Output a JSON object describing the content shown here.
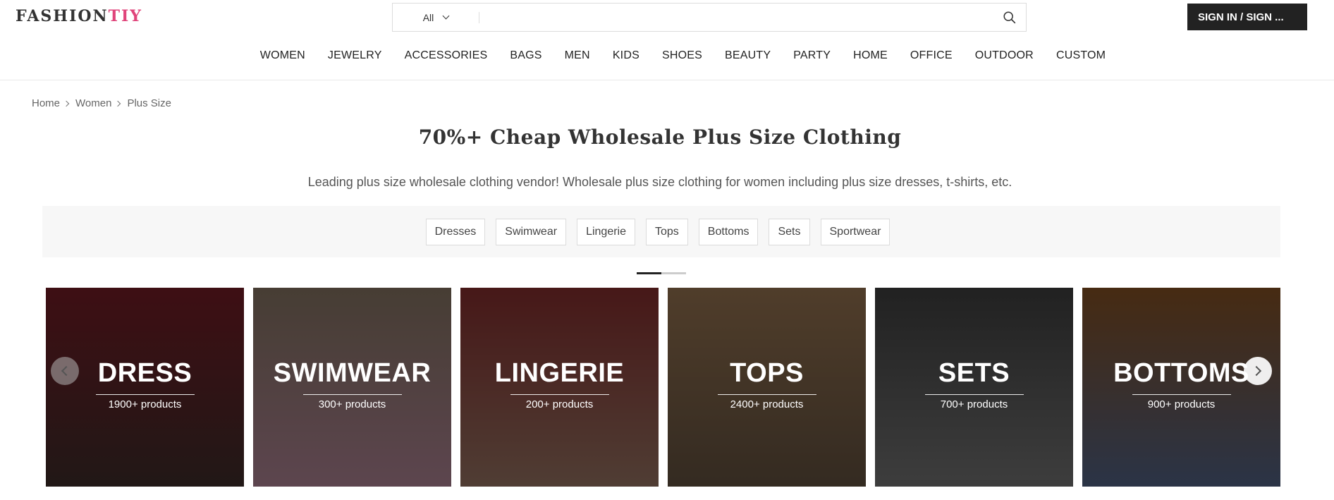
{
  "logo": {
    "main": "FASHION",
    "accent": "TIY"
  },
  "search": {
    "category": "All",
    "placeholder": ""
  },
  "signin_label": "SIGN IN / SIGN ...",
  "nav": [
    "WOMEN",
    "JEWELRY",
    "ACCESSORIES",
    "BAGS",
    "MEN",
    "KIDS",
    "SHOES",
    "BEAUTY",
    "PARTY",
    "HOME",
    "OFFICE",
    "OUTDOOR",
    "CUSTOM"
  ],
  "breadcrumb": [
    "Home",
    "Women",
    "Plus Size"
  ],
  "title": "70%+ Cheap Wholesale Plus Size Clothing",
  "description": "Leading plus size wholesale clothing vendor! Wholesale plus size clothing for women including plus size dresses, t-shirts, etc.",
  "filters": [
    "Dresses",
    "Swimwear",
    "Lingerie",
    "Tops",
    "Bottoms",
    "Sets",
    "Sportwear"
  ],
  "carousel": {
    "page": 1,
    "page_count": 2,
    "cards": [
      {
        "name": "DRESS",
        "count": "1900+ products",
        "colors": [
          "#6b1a24",
          "#3a2a26"
        ]
      },
      {
        "name": "SWIMWEAR",
        "count": "300+ products",
        "colors": [
          "#7a6a5a",
          "#a07888"
        ]
      },
      {
        "name": "LINGERIE",
        "count": "200+ products",
        "colors": [
          "#7a2a2a",
          "#8a6a5a"
        ]
      },
      {
        "name": "TOPS",
        "count": "2400+ products",
        "colors": [
          "#8a6a4a",
          "#5a4a3a"
        ]
      },
      {
        "name": "SETS",
        "count": "700+ products",
        "colors": [
          "#3a3a3a",
          "#6a6a6a"
        ]
      },
      {
        "name": "BOTTOMS",
        "count": "900+ products",
        "colors": [
          "#7a4a20",
          "#4a5a7a"
        ]
      }
    ]
  },
  "colors": {
    "brand_accent": "#e0457b",
    "button_dark": "#222222"
  }
}
